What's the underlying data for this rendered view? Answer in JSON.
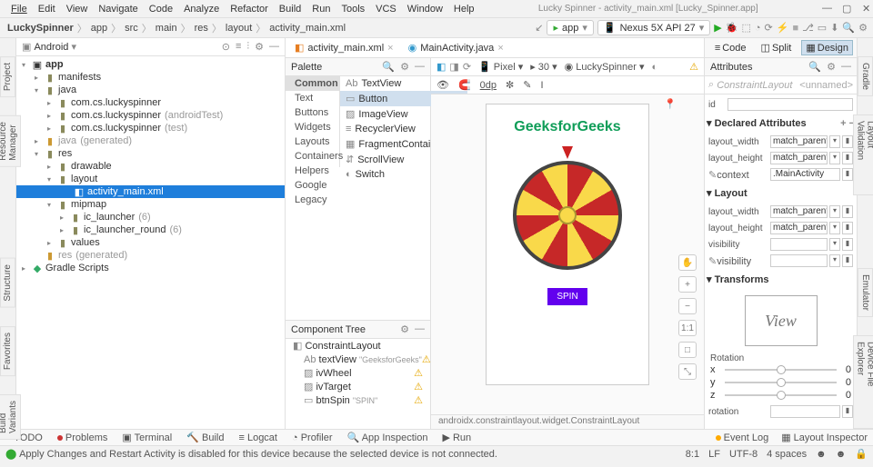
{
  "menu": {
    "file": "File",
    "edit": "Edit",
    "view": "View",
    "navigate": "Navigate",
    "code": "Code",
    "analyze": "Analyze",
    "refactor": "Refactor",
    "build": "Build",
    "run": "Run",
    "tools": "Tools",
    "vcs": "VCS",
    "window": "Window",
    "help": "Help"
  },
  "window_title": "Lucky Spinner - activity_main.xml [Lucky_Spinner.app]",
  "breadcrumb": {
    "project": "LuckySpinner",
    "app": "app",
    "src": "src",
    "main": "main",
    "res": "res",
    "layout": "layout",
    "file": "activity_main.xml"
  },
  "run_config": {
    "module": "app",
    "device": "Nexus 5X API 27"
  },
  "project_tool": {
    "title": "Android"
  },
  "tree": {
    "app": "app",
    "manifests": "manifests",
    "java": "java",
    "pkg": "com.cs.luckyspinner",
    "pkg_androidtest": "com.cs.luckyspinner",
    "pkg_androidtest_suffix": "(androidTest)",
    "pkg_test": "com.cs.luckyspinner",
    "pkg_test_suffix": "(test)",
    "java_gen": "java",
    "java_gen_suffix": "(generated)",
    "res": "res",
    "drawable": "drawable",
    "layout": "layout",
    "act_main": "activity_main.xml",
    "mipmap": "mipmap",
    "ic_launcher": "ic_launcher",
    "ic_launcher_suffix": "(6)",
    "ic_launcher_round": "ic_launcher_round",
    "ic_launcher_round_suffix": "(6)",
    "values": "values",
    "res_gen": "res",
    "res_gen_suffix": "(generated)",
    "gradle": "Gradle Scripts"
  },
  "tabs": {
    "activity_main": "activity_main.xml",
    "main_activity": "MainActivity.java"
  },
  "palette": {
    "title": "Palette",
    "cats": {
      "common": "Common",
      "text": "Text",
      "buttons": "Buttons",
      "widgets": "Widgets",
      "layouts": "Layouts",
      "containers": "Containers",
      "helpers": "Helpers",
      "google": "Google",
      "legacy": "Legacy"
    },
    "items": {
      "textview": "TextView",
      "button": "Button",
      "imageview": "ImageView",
      "recyclerview": "RecyclerView",
      "fragmentcv": "FragmentContainerVi...",
      "scrollview": "ScrollView",
      "switch": "Switch"
    }
  },
  "design_toolbar": {
    "pixel": "Pixel",
    "api": "30",
    "theme": "LuckySpinner",
    "default_dp": "0dp"
  },
  "preview": {
    "title": "GeeksforGeeks",
    "spin": "SPIN"
  },
  "zoom": {
    "plus": "+",
    "minus": "−",
    "one": "1:1",
    "fit": "□"
  },
  "comptree": {
    "title": "Component Tree",
    "root": "ConstraintLayout",
    "textview": "textView",
    "textview_val": "\"GeeksforGeeks\"",
    "ivwheel": "ivWheel",
    "ivtarget": "ivTarget",
    "btnspin": "btnSpin",
    "btnspin_val": "\"SPIN\""
  },
  "modes": {
    "code": "Code",
    "split": "Split",
    "design": "Design"
  },
  "attributes": {
    "title": "Attributes",
    "search_ph": "ConstraintLayout",
    "unnamed": "<unnamed>",
    "id_lbl": "id",
    "declared": "Declared Attributes",
    "layout_width": "layout_width",
    "layout_height": "layout_height",
    "context": "context",
    "match_parent": "match_parent",
    "main_activity": ".MainActivity",
    "layout_sec": "Layout",
    "visibility": "visibility",
    "pvisibility": "visibility",
    "transforms": "Transforms",
    "view": "View",
    "rotation": "Rotation",
    "x": "x",
    "y": "y",
    "z": "z",
    "zero": "0",
    "rotation2": "rotation"
  },
  "component_path": "androidx.constraintlayout.widget.ConstraintLayout",
  "bottom": {
    "todo": "TODO",
    "problems": "Problems",
    "terminal": "Terminal",
    "build": "Build",
    "logcat": "Logcat",
    "profiler": "Profiler",
    "appinsp": "App Inspection",
    "run": "Run",
    "eventlog": "Event Log",
    "layoutinsp": "Layout Inspector"
  },
  "status": {
    "msg": "Apply Changes and Restart Activity is disabled for this device because the selected device is not connected.",
    "pos": "8:1",
    "lf": "LF",
    "enc": "UTF-8",
    "spaces": "4 spaces"
  },
  "side_tabs": {
    "project": "Project",
    "res_mgr": "Resource Manager",
    "structure": "Structure",
    "favorites": "Favorites",
    "build_var": "Build Variants",
    "gradle": "Gradle",
    "layout_val": "Layout Validation",
    "emulator": "Emulator",
    "dev_file": "Device File Explorer"
  }
}
